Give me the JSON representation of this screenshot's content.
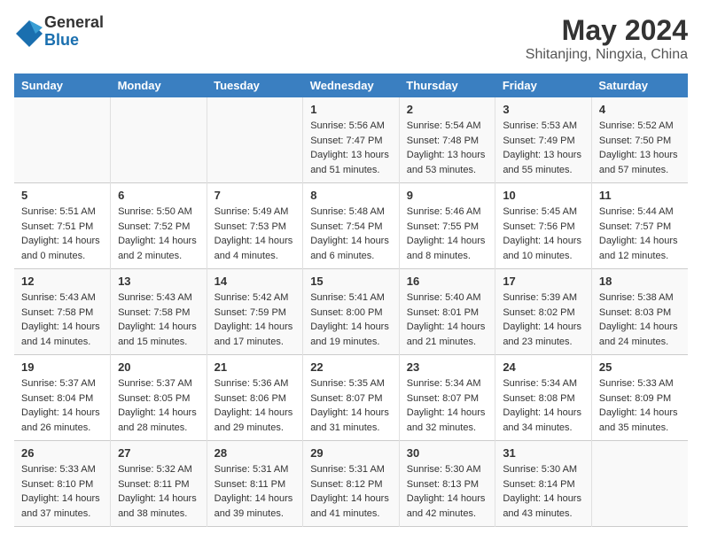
{
  "header": {
    "logo_general": "General",
    "logo_blue": "Blue",
    "month_year": "May 2024",
    "location": "Shitanjing, Ningxia, China"
  },
  "days_of_week": [
    "Sunday",
    "Monday",
    "Tuesday",
    "Wednesday",
    "Thursday",
    "Friday",
    "Saturday"
  ],
  "weeks": [
    [
      {
        "day": "",
        "info": ""
      },
      {
        "day": "",
        "info": ""
      },
      {
        "day": "",
        "info": ""
      },
      {
        "day": "1",
        "info": "Sunrise: 5:56 AM\nSunset: 7:47 PM\nDaylight: 13 hours and 51 minutes."
      },
      {
        "day": "2",
        "info": "Sunrise: 5:54 AM\nSunset: 7:48 PM\nDaylight: 13 hours and 53 minutes."
      },
      {
        "day": "3",
        "info": "Sunrise: 5:53 AM\nSunset: 7:49 PM\nDaylight: 13 hours and 55 minutes."
      },
      {
        "day": "4",
        "info": "Sunrise: 5:52 AM\nSunset: 7:50 PM\nDaylight: 13 hours and 57 minutes."
      }
    ],
    [
      {
        "day": "5",
        "info": "Sunrise: 5:51 AM\nSunset: 7:51 PM\nDaylight: 14 hours and 0 minutes."
      },
      {
        "day": "6",
        "info": "Sunrise: 5:50 AM\nSunset: 7:52 PM\nDaylight: 14 hours and 2 minutes."
      },
      {
        "day": "7",
        "info": "Sunrise: 5:49 AM\nSunset: 7:53 PM\nDaylight: 14 hours and 4 minutes."
      },
      {
        "day": "8",
        "info": "Sunrise: 5:48 AM\nSunset: 7:54 PM\nDaylight: 14 hours and 6 minutes."
      },
      {
        "day": "9",
        "info": "Sunrise: 5:46 AM\nSunset: 7:55 PM\nDaylight: 14 hours and 8 minutes."
      },
      {
        "day": "10",
        "info": "Sunrise: 5:45 AM\nSunset: 7:56 PM\nDaylight: 14 hours and 10 minutes."
      },
      {
        "day": "11",
        "info": "Sunrise: 5:44 AM\nSunset: 7:57 PM\nDaylight: 14 hours and 12 minutes."
      }
    ],
    [
      {
        "day": "12",
        "info": "Sunrise: 5:43 AM\nSunset: 7:58 PM\nDaylight: 14 hours and 14 minutes."
      },
      {
        "day": "13",
        "info": "Sunrise: 5:43 AM\nSunset: 7:58 PM\nDaylight: 14 hours and 15 minutes."
      },
      {
        "day": "14",
        "info": "Sunrise: 5:42 AM\nSunset: 7:59 PM\nDaylight: 14 hours and 17 minutes."
      },
      {
        "day": "15",
        "info": "Sunrise: 5:41 AM\nSunset: 8:00 PM\nDaylight: 14 hours and 19 minutes."
      },
      {
        "day": "16",
        "info": "Sunrise: 5:40 AM\nSunset: 8:01 PM\nDaylight: 14 hours and 21 minutes."
      },
      {
        "day": "17",
        "info": "Sunrise: 5:39 AM\nSunset: 8:02 PM\nDaylight: 14 hours and 23 minutes."
      },
      {
        "day": "18",
        "info": "Sunrise: 5:38 AM\nSunset: 8:03 PM\nDaylight: 14 hours and 24 minutes."
      }
    ],
    [
      {
        "day": "19",
        "info": "Sunrise: 5:37 AM\nSunset: 8:04 PM\nDaylight: 14 hours and 26 minutes."
      },
      {
        "day": "20",
        "info": "Sunrise: 5:37 AM\nSunset: 8:05 PM\nDaylight: 14 hours and 28 minutes."
      },
      {
        "day": "21",
        "info": "Sunrise: 5:36 AM\nSunset: 8:06 PM\nDaylight: 14 hours and 29 minutes."
      },
      {
        "day": "22",
        "info": "Sunrise: 5:35 AM\nSunset: 8:07 PM\nDaylight: 14 hours and 31 minutes."
      },
      {
        "day": "23",
        "info": "Sunrise: 5:34 AM\nSunset: 8:07 PM\nDaylight: 14 hours and 32 minutes."
      },
      {
        "day": "24",
        "info": "Sunrise: 5:34 AM\nSunset: 8:08 PM\nDaylight: 14 hours and 34 minutes."
      },
      {
        "day": "25",
        "info": "Sunrise: 5:33 AM\nSunset: 8:09 PM\nDaylight: 14 hours and 35 minutes."
      }
    ],
    [
      {
        "day": "26",
        "info": "Sunrise: 5:33 AM\nSunset: 8:10 PM\nDaylight: 14 hours and 37 minutes."
      },
      {
        "day": "27",
        "info": "Sunrise: 5:32 AM\nSunset: 8:11 PM\nDaylight: 14 hours and 38 minutes."
      },
      {
        "day": "28",
        "info": "Sunrise: 5:31 AM\nSunset: 8:11 PM\nDaylight: 14 hours and 39 minutes."
      },
      {
        "day": "29",
        "info": "Sunrise: 5:31 AM\nSunset: 8:12 PM\nDaylight: 14 hours and 41 minutes."
      },
      {
        "day": "30",
        "info": "Sunrise: 5:30 AM\nSunset: 8:13 PM\nDaylight: 14 hours and 42 minutes."
      },
      {
        "day": "31",
        "info": "Sunrise: 5:30 AM\nSunset: 8:14 PM\nDaylight: 14 hours and 43 minutes."
      },
      {
        "day": "",
        "info": ""
      }
    ]
  ]
}
